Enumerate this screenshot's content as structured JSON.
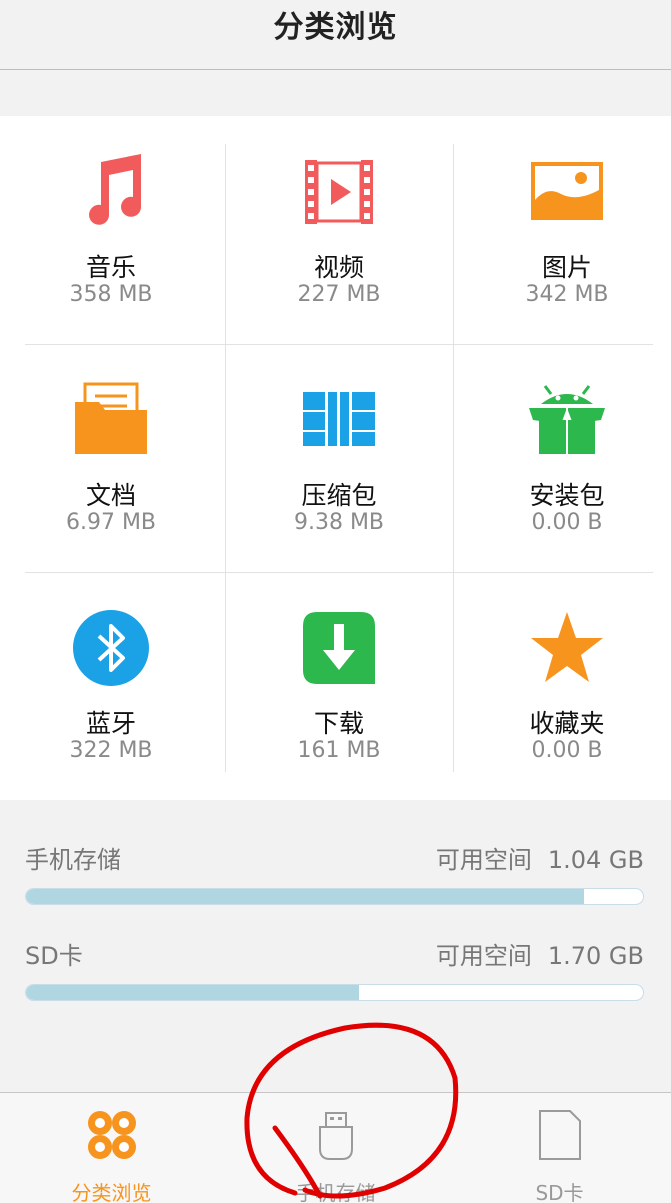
{
  "header": {
    "title": "分类浏览"
  },
  "categories": [
    {
      "name": "音乐",
      "size": "358 MB",
      "icon": "music-note-icon",
      "color": "#f25b5b"
    },
    {
      "name": "视频",
      "size": "227 MB",
      "icon": "video-film-icon",
      "color": "#f25b5b"
    },
    {
      "name": "图片",
      "size": "342 MB",
      "icon": "image-icon",
      "color": "#f7941d"
    },
    {
      "name": "文档",
      "size": "6.97 MB",
      "icon": "document-folder-icon",
      "color": "#f7941d"
    },
    {
      "name": "压缩包",
      "size": "9.38 MB",
      "icon": "archive-icon",
      "color": "#1aa1e6"
    },
    {
      "name": "安装包",
      "size": "0.00 B",
      "icon": "android-package-icon",
      "color": "#2db84d"
    },
    {
      "name": "蓝牙",
      "size": "322 MB",
      "icon": "bluetooth-icon",
      "color": "#1aa1e6"
    },
    {
      "name": "下载",
      "size": "161 MB",
      "icon": "download-icon",
      "color": "#2db84d"
    },
    {
      "name": "收藏夹",
      "size": "0.00 B",
      "icon": "star-icon",
      "color": "#f7941d"
    }
  ],
  "storage": [
    {
      "label": "手机存储",
      "free_label": "可用空间",
      "free_value": "1.04 GB",
      "used_fraction": 0.904
    },
    {
      "label": "SD卡",
      "free_label": "可用空间",
      "free_value": "1.70 GB",
      "used_fraction": 0.54
    }
  ],
  "tabs": [
    {
      "label": "分类浏览",
      "icon": "category-grid-icon",
      "active": true
    },
    {
      "label": "手机存储",
      "icon": "usb-storage-icon",
      "active": false
    },
    {
      "label": "SD卡",
      "icon": "sd-card-icon",
      "active": false
    }
  ],
  "colors": {
    "accent": "#f7941d",
    "bar_fill": "#b0d6e2",
    "annotation": "#e00000"
  }
}
